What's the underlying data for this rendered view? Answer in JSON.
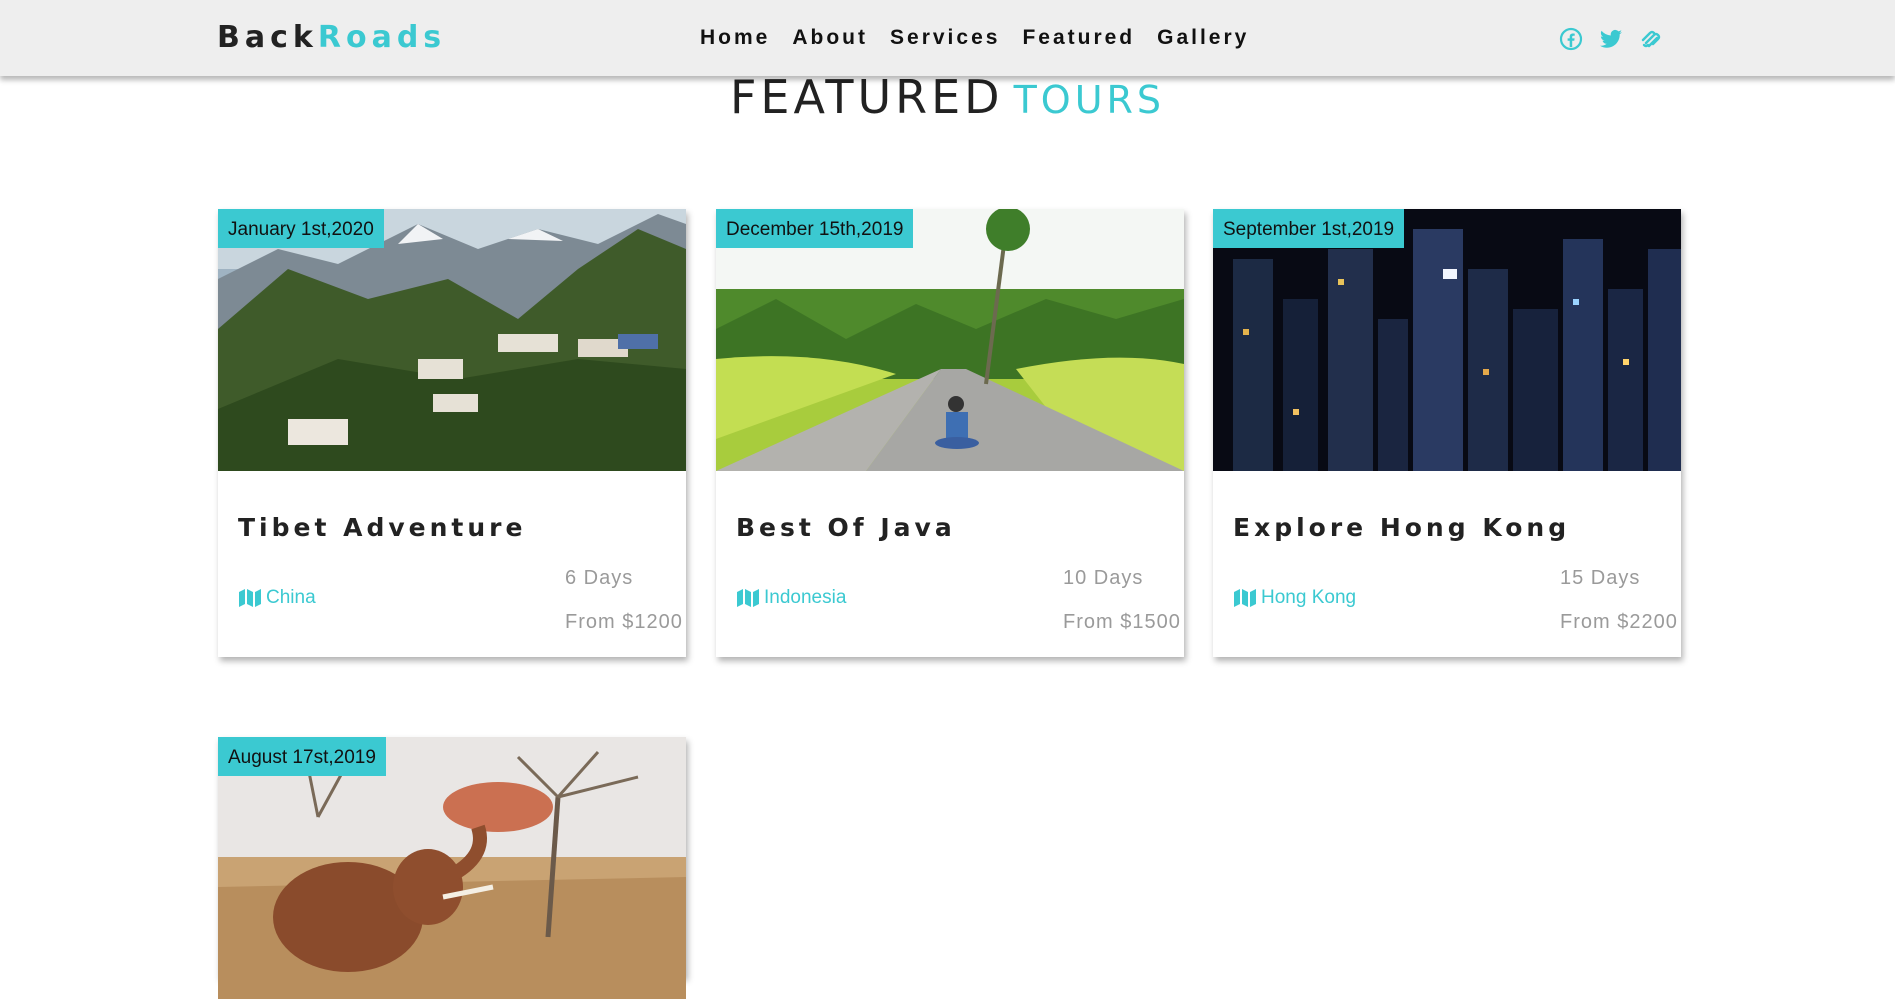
{
  "brand": {
    "part1": "Back",
    "part2": "Roads"
  },
  "nav": [
    "Home",
    "About",
    "Services",
    "Featured",
    "Gallery"
  ],
  "social": [
    "facebook-icon",
    "twitter-icon",
    "squarespace-icon"
  ],
  "colors": {
    "accent": "#3bc9d1",
    "navbar": "#eeeeee",
    "muted": "#9a9a9a"
  },
  "section": {
    "title_main": "FEATURED",
    "title_accent": "TOURS"
  },
  "tours": [
    {
      "date": "January 1st,2020",
      "title": "Tibet Adventure",
      "location": "China",
      "days": "6 Days",
      "price": "From $1200",
      "image": "mountain-village-photo"
    },
    {
      "date": "December 15th,2019",
      "title": "Best Of Java",
      "location": "Indonesia",
      "days": "10 Days",
      "price": "From $1500",
      "image": "tropical-road-photo"
    },
    {
      "date": "September 1st,2019",
      "title": "Explore Hong Kong",
      "location": "Hong Kong",
      "days": "15 Days",
      "price": "From $2200",
      "image": "city-night-photo"
    },
    {
      "date": "August 17st,2019",
      "image": "elephant-savanna-photo"
    }
  ]
}
